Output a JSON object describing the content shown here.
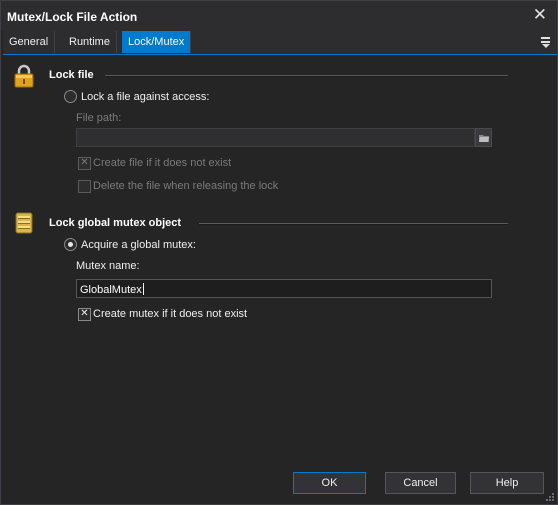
{
  "window": {
    "title": "Mutex/Lock File Action"
  },
  "tabs": [
    {
      "label": "General"
    },
    {
      "label": "Runtime"
    },
    {
      "label": "Lock/Mutex",
      "active": true
    }
  ],
  "lock_file": {
    "section_title": "Lock file",
    "radio_label": "Lock a file against access:",
    "radio_selected": false,
    "path_label": "File path:",
    "path_value": "",
    "create_label": "Create file if it does not exist",
    "create_checked": true,
    "delete_label": "Delete the file when releasing the lock",
    "delete_checked": false
  },
  "mutex": {
    "section_title": "Lock global mutex object",
    "radio_label": "Acquire a global mutex:",
    "radio_selected": true,
    "name_label": "Mutex name:",
    "name_value": "GlobalMutex",
    "create_label": "Create mutex if it does not exist",
    "create_checked": true
  },
  "buttons": {
    "ok": "OK",
    "cancel": "Cancel",
    "help": "Help"
  },
  "icons": {
    "close": "close-icon",
    "tab_menu": "menu-icon",
    "lock": "padlock-icon",
    "mutex": "database-icon",
    "folder": "folder-icon"
  },
  "colors": {
    "accent": "#007acc",
    "background": "#252526",
    "titlebar": "#2d2d30"
  }
}
